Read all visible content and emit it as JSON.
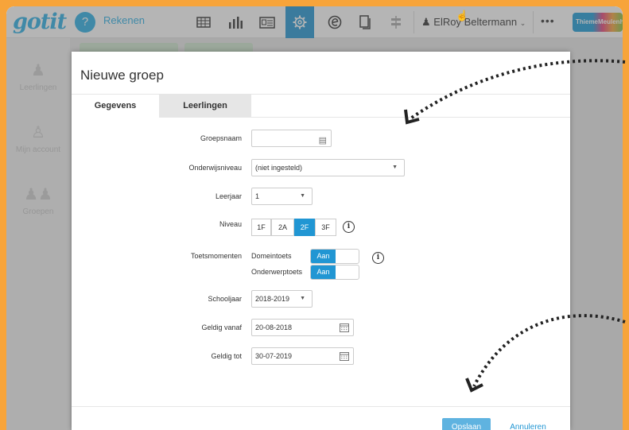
{
  "topbar": {
    "logo_text": "gotit",
    "logo_badge": "?",
    "subject": "Rekenen",
    "tools": [
      "table-icon",
      "chart-icon",
      "list-icon",
      "gear-icon",
      "e-icon",
      "document-icon",
      "signpost-icon"
    ],
    "user_name": "ElRoy Beltermann",
    "more": "•••",
    "brand": "ThiemeMeulenhoff"
  },
  "sidebar": {
    "items": [
      {
        "label": "Leerlingen",
        "icon": "user-icon"
      },
      {
        "label": "Mijn account",
        "icon": "account-icon"
      },
      {
        "label": "Groepen",
        "icon": "group-icon"
      }
    ]
  },
  "modal": {
    "title": "Nieuwe groep",
    "tabs": [
      "Gegevens",
      "Leerlingen"
    ],
    "fields": {
      "groepsnaam_label": "Groepsnaam",
      "groepsnaam_value": "",
      "onderwijsniveau_label": "Onderwijsniveau",
      "onderwijsniveau_value": "(niet ingesteld)",
      "leerjaar_label": "Leerjaar",
      "leerjaar_value": "1",
      "niveau_label": "Niveau",
      "niveau_options": [
        "1F",
        "2A",
        "2F",
        "3F"
      ],
      "niveau_selected": "2F",
      "toetsmomenten_label": "Toetsmomenten",
      "domeintoets_label": "Domeintoets",
      "domeintoets_value": "Aan",
      "onderwerptoets_label": "Onderwerptoets",
      "onderwerptoets_value": "Aan",
      "schooljaar_label": "Schooljaar",
      "schooljaar_value": "2018-2019",
      "geldig_vanaf_label": "Geldig vanaf",
      "geldig_vanaf_value": "20-08-2018",
      "geldig_tot_label": "Geldig tot",
      "geldig_tot_value": "30-07-2019"
    },
    "save_label": "Opslaan",
    "cancel_label": "Annuleren"
  },
  "colors": {
    "frame_background": "#f7a43a",
    "accent": "#2196d3",
    "logo": "#2ab0e6"
  }
}
